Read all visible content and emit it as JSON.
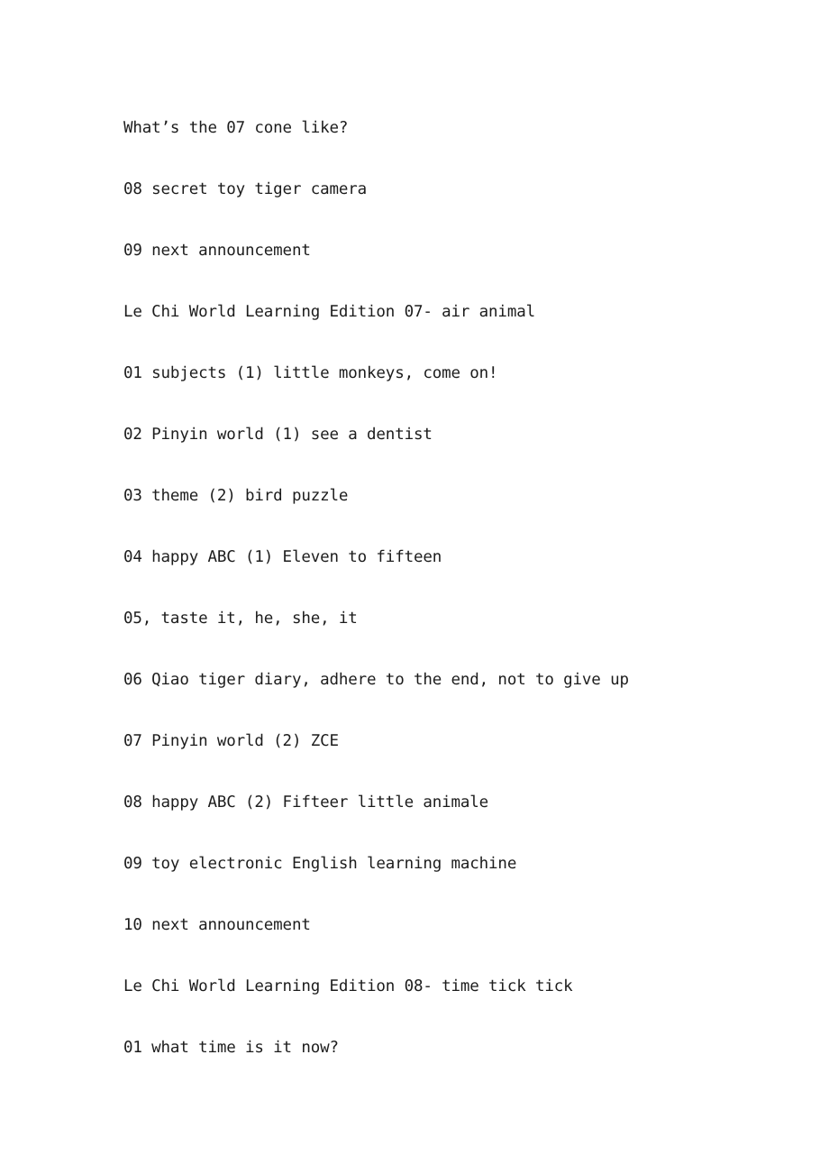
{
  "document": {
    "background_color": "#ffffff",
    "text_color": "#1c1c1c",
    "lines": [
      {
        "id": "line-1",
        "kind": "item",
        "text": "What’s the 07 cone like?"
      },
      {
        "id": "line-2",
        "kind": "item",
        "text": "08 secret toy tiger camera"
      },
      {
        "id": "line-3",
        "kind": "item",
        "text": "09 next announcement"
      },
      {
        "id": "line-4",
        "kind": "heading",
        "text": "Le Chi World Learning Edition 07- air animal"
      },
      {
        "id": "line-5",
        "kind": "item",
        "text": "01 subjects (1) little monkeys, come on!"
      },
      {
        "id": "line-6",
        "kind": "item",
        "text": "02 Pinyin world (1) see a dentist"
      },
      {
        "id": "line-7",
        "kind": "item",
        "text": "03 theme (2) bird puzzle"
      },
      {
        "id": "line-8",
        "kind": "item",
        "text": "04 happy ABC (1) Eleven to fifteen"
      },
      {
        "id": "line-9",
        "kind": "item",
        "text": "05, taste it, he, she, it"
      },
      {
        "id": "line-10",
        "kind": "item",
        "text": "06 Qiao tiger diary, adhere to the end, not to give up"
      },
      {
        "id": "line-11",
        "kind": "item",
        "text": "07 Pinyin world (2) ZCE"
      },
      {
        "id": "line-12",
        "kind": "item",
        "text": "08 happy ABC (2) Fifteer little animale"
      },
      {
        "id": "line-13",
        "kind": "item",
        "text": "09 toy electronic English learning machine"
      },
      {
        "id": "line-14",
        "kind": "item",
        "text": "10 next announcement"
      },
      {
        "id": "line-15",
        "kind": "heading",
        "text": "Le Chi World Learning Edition 08- time tick tick"
      },
      {
        "id": "line-16",
        "kind": "item",
        "text": "01 what time is it now?"
      }
    ]
  }
}
